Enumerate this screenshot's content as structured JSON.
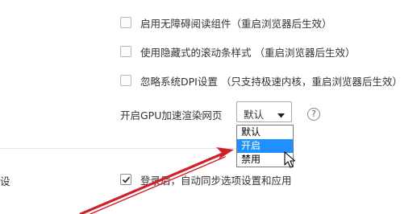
{
  "settings": {
    "accessibility": {
      "label": "启用无障碍阅读组件（重启浏览器后生效）",
      "checked": false
    },
    "hidden_scrollbar": {
      "label": "使用隐藏式的滚动条样式 （重启浏览器后生效）",
      "checked": false
    },
    "ignore_dpi": {
      "label": "忽略系统DPI设置 （只支持极速内核，重启浏览器后生效）",
      "checked": false
    },
    "gpu": {
      "label": "开启GPU加速渲染网页",
      "selected": "默认",
      "options": [
        "默认",
        "开启",
        "禁用"
      ],
      "highlighted_option": "开启",
      "help_icon_glyph": "?"
    },
    "sync": {
      "label": "登录后，自动同步选项设置和应用",
      "checked": true
    },
    "left_cut_label": "设"
  },
  "colors": {
    "highlight": "#1e90ff",
    "arrow": "#d0202a",
    "checkbox_border": "#b9b9b9"
  }
}
